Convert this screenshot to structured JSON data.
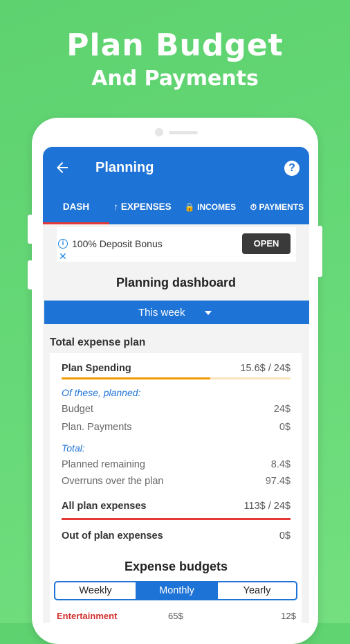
{
  "hero": {
    "title": "Plan Budget",
    "subtitle": "And Payments"
  },
  "appbar": {
    "title": "Planning",
    "help_icon": "?"
  },
  "tabs": [
    {
      "label": "DASH",
      "active": true
    },
    {
      "label": "↑ EXPENSES"
    },
    {
      "label": "🔒 INCOMES"
    },
    {
      "label": "⏱ PAYMENTS"
    }
  ],
  "ad": {
    "text": "100% Deposit Bonus",
    "button": "OPEN",
    "info_icon": "i",
    "close_icon": "✕"
  },
  "dashboard": {
    "title": "Planning dashboard",
    "period": "This week",
    "section_title": "Total expense plan",
    "plan_spending": {
      "label": "Plan Spending",
      "value": "15.6$ / 24$",
      "progress": 0.65
    },
    "planned_heading": "Of these, planned:",
    "budget": {
      "label": "Budget",
      "value": "24$"
    },
    "plan_payments": {
      "label": "Plan. Payments",
      "value": "0$"
    },
    "total_heading": "Total:",
    "planned_remaining": {
      "label": "Planned remaining",
      "value": "8.4$"
    },
    "overruns": {
      "label": "Overruns over the plan",
      "value": "97.4$"
    },
    "all_plan": {
      "label": "All plan expenses",
      "value": "113$ / 24$"
    },
    "out_of_plan": {
      "label": "Out of plan expenses",
      "value": "0$"
    }
  },
  "budgets": {
    "title": "Expense budgets",
    "segments": [
      "Weekly",
      "Monthly",
      "Yearly"
    ],
    "active_segment": "Monthly",
    "rows": [
      {
        "name": "Entertainment",
        "spent": "65$",
        "limit": "12$"
      }
    ]
  },
  "colors": {
    "primary": "#1e73d6",
    "accent_red": "#e53935",
    "progress": "#f29a00",
    "background": "#64d673"
  }
}
